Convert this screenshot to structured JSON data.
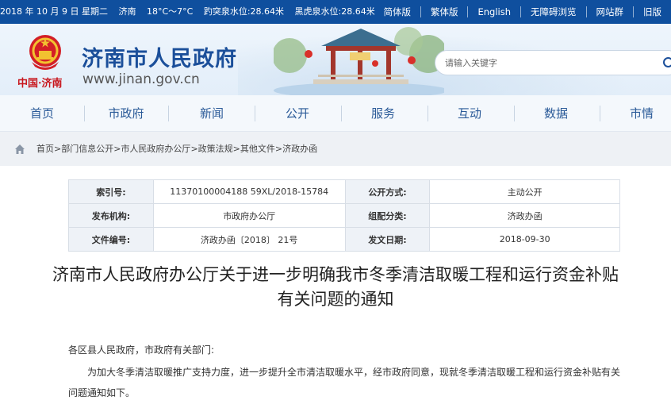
{
  "topbar": {
    "date": "2018 年 10 月 9 日 星期二",
    "city": "济南",
    "temperature": "18°C～7°C",
    "baotu_spring": "趵突泉水位:28.64米",
    "heihu_spring": "黑虎泉水位:28.64米",
    "links": [
      "简体版",
      "繁体版",
      "English",
      "无障碍浏览",
      "网站群",
      "旧版"
    ]
  },
  "header": {
    "emblem_text": "中国·济南",
    "site_title": "济南市人民政府",
    "site_url": "www.jinan.gov.cn",
    "search_placeholder": "请输入关键字"
  },
  "nav": [
    "首页",
    "市政府",
    "新闻",
    "公开",
    "服务",
    "互动",
    "数据",
    "市情"
  ],
  "breadcrumb": [
    "首页",
    "部门信息公开",
    "市人民政府办公厅",
    "政策法规",
    "其他文件",
    "济政办函"
  ],
  "meta": {
    "index_label": "索引号:",
    "index_value": "11370100004188 59XL/2018-15784",
    "publicity_label": "公开方式:",
    "publicity_value": "主动公开",
    "publisher_label": "发布机构:",
    "publisher_value": "市政府办公厅",
    "category_label": "组配分类:",
    "category_value": "济政办函",
    "doc_no_label": "文件编号:",
    "doc_no_value": "济政办函〔2018〕 21号",
    "date_label": "发文日期:",
    "date_value": "2018-09-30"
  },
  "document": {
    "title": "济南市人民政府办公厅关于进一步明确我市冬季清洁取暖工程和运行资金补贴有关问题的通知",
    "greeting": "各区县人民政府，市政府有关部门:",
    "paragraph": "为加大冬季清洁取暖推广支持力度，进一步提升全市清洁取暖水平，经市政府同意，现就冬季清洁取暖工程和运行资金补贴有关问题通知如下。"
  },
  "colors": {
    "topbar_bg": "#0f4f9e",
    "title_blue": "#1b4f9a",
    "nav_text": "#2a5a98",
    "emblem_red": "#c8161d"
  },
  "icons": [
    "national-emblem-icon",
    "search-icon",
    "home-icon"
  ]
}
